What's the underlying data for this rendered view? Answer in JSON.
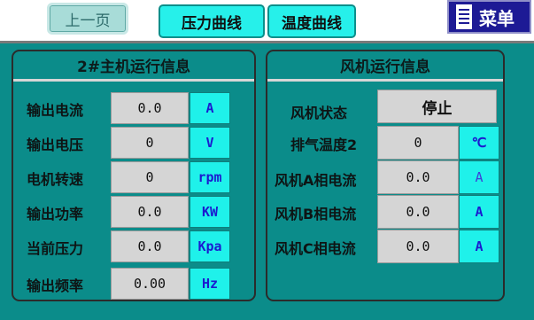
{
  "header": {
    "prev_label": "上一页",
    "tab_pressure": "压力曲线",
    "tab_temperature": "温度曲线",
    "menu_label": "菜单"
  },
  "left_panel": {
    "title": "2#主机运行信息",
    "rows": [
      {
        "label": "输出电流",
        "value": "0.0",
        "unit": "A"
      },
      {
        "label": "输出电压",
        "value": "0",
        "unit": "V"
      },
      {
        "label": "电机转速",
        "value": "0",
        "unit": "rpm"
      },
      {
        "label": "输出功率",
        "value": "0.0",
        "unit": "KW"
      },
      {
        "label": "当前压力",
        "value": "0.0",
        "unit": "Kpa"
      },
      {
        "label": "输出频率",
        "value": "0.00",
        "unit": "Hz"
      }
    ]
  },
  "right_panel": {
    "title": "风机运行信息",
    "status_label": "风机状态",
    "status_value": "停止",
    "rows": [
      {
        "label": "排气温度2",
        "value": "0",
        "unit": "℃"
      },
      {
        "label": "风机A相电流",
        "value": "0.0",
        "unit": "A"
      },
      {
        "label": "风机B相电流",
        "value": "0.0",
        "unit": "A"
      },
      {
        "label": "风机C相电流",
        "value": "0.0",
        "unit": "A"
      }
    ]
  },
  "colors": {
    "background": "#0b8c8a",
    "tab_cyan": "#26f0ea",
    "menu_blue": "#1d1a95",
    "value_grey": "#d5d5d5",
    "unit_text": "#1b1bd0"
  }
}
